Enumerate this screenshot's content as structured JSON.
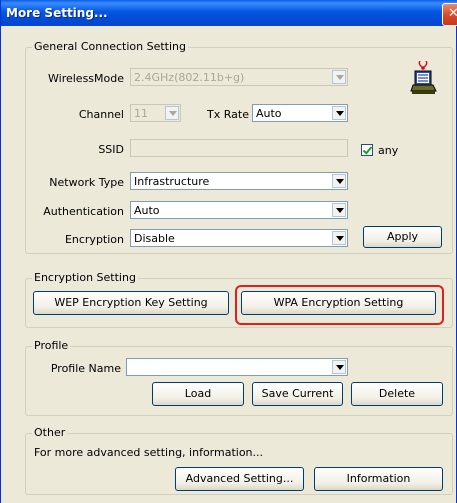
{
  "window": {
    "title": "More Setting...",
    "close_glyph": "✕"
  },
  "general": {
    "legend": "General Connection Setting",
    "wireless_mode_label": "WirelessMode",
    "wireless_mode_value": "2.4GHz(802.11b+g)",
    "channel_label": "Channel",
    "channel_value": "11",
    "tx_rate_label": "Tx Rate",
    "tx_rate_value": "Auto",
    "ssid_label": "SSID",
    "ssid_value": "",
    "any_label": "any",
    "network_type_label": "Network Type",
    "network_type_value": "Infrastructure",
    "authentication_label": "Authentication",
    "authentication_value": "Auto",
    "encryption_label": "Encryption",
    "encryption_value": "Disable",
    "apply_label": "Apply"
  },
  "encryption": {
    "legend": "Encryption Setting",
    "wep_label": "WEP Encryption Key Setting",
    "wpa_label": "WPA Encryption Setting"
  },
  "profile": {
    "legend": "Profile",
    "name_label": "Profile Name",
    "name_value": "",
    "load_label": "Load",
    "save_label": "Save Current",
    "delete_label": "Delete"
  },
  "other": {
    "legend": "Other",
    "description": "For more advanced setting, information...",
    "advanced_label": "Advanced Setting...",
    "information_label": "Information"
  },
  "icons": {
    "network": "network-device-icon",
    "close": "close-icon"
  },
  "colors": {
    "titlebar": "#0558e0",
    "highlight": "#e02020",
    "dialog_bg": "#ece9d8"
  }
}
